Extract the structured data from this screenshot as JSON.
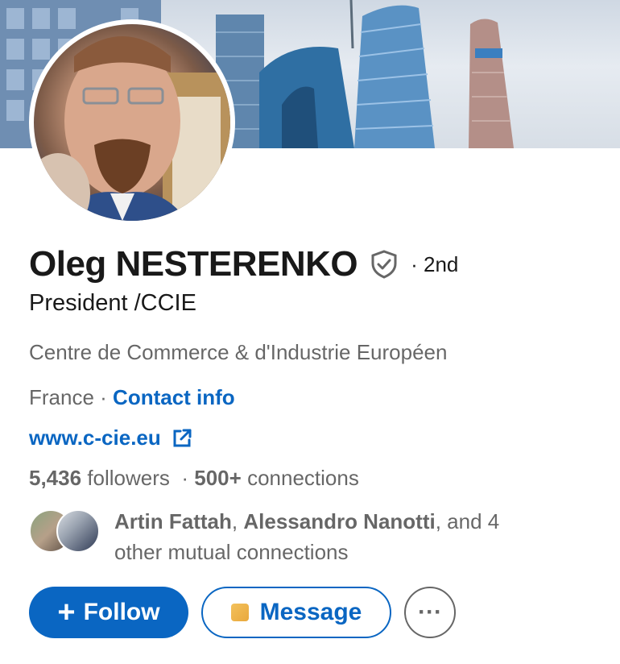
{
  "profile": {
    "name": "Oleg NESTERENKO",
    "verified_icon": "shield-check-icon",
    "degree": "· 2nd",
    "headline": "President /CCIE",
    "company": "Centre de Commerce & d'Industrie Européen",
    "location": "France ·",
    "contact_info_label": "Contact info",
    "website": "www.c-cie.eu",
    "website_icon": "external-link-icon"
  },
  "stats": {
    "followers_count": "5,436",
    "followers_label": "followers",
    "separator": "·",
    "connections_count": "500+",
    "connections_label": "connections"
  },
  "mutual": {
    "name_1": "Artin Fattah",
    "sep": ",",
    "name_2": "Alessandro Nanotti",
    "tail": ", and 4 other mutual connections"
  },
  "actions": {
    "follow_plus": "+",
    "follow_label": "Follow",
    "message_label": "Message",
    "more_label": "···"
  },
  "colors": {
    "accent": "#0a66c2",
    "secondary_text": "#00000099"
  }
}
